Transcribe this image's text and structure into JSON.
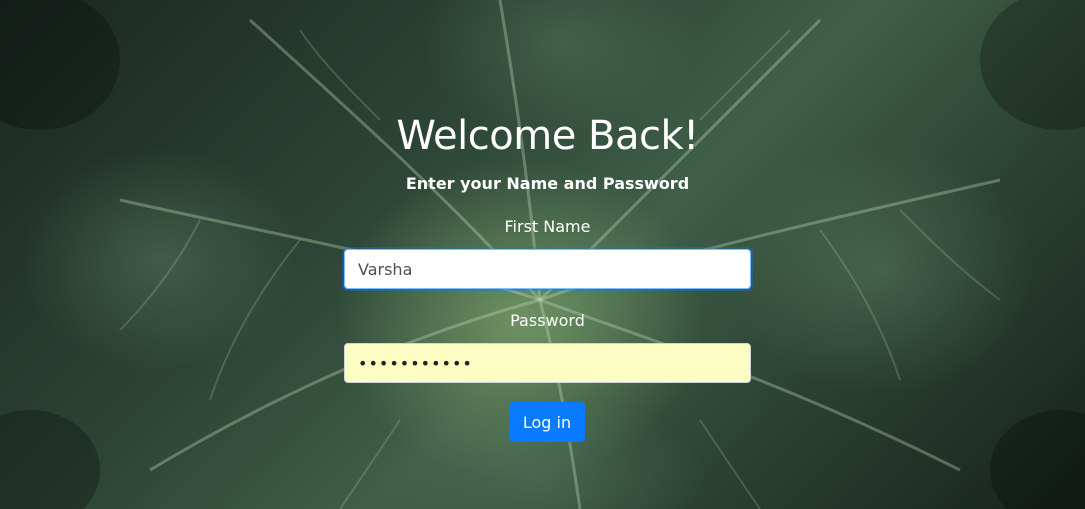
{
  "page": {
    "title": "Welcome Back!",
    "subtitle": "Enter your Name and Password"
  },
  "form": {
    "first_name_label": "First Name",
    "first_name_value": "Varsha",
    "password_label": "Password",
    "password_value": "•••••••••••",
    "login_label": "Log in"
  },
  "colors": {
    "button": "#0a7bff",
    "password_autofill_bg": "#fcfdc3",
    "text": "#ffffff"
  },
  "background": {
    "description_icon": "cabbage-leaves-photo"
  }
}
